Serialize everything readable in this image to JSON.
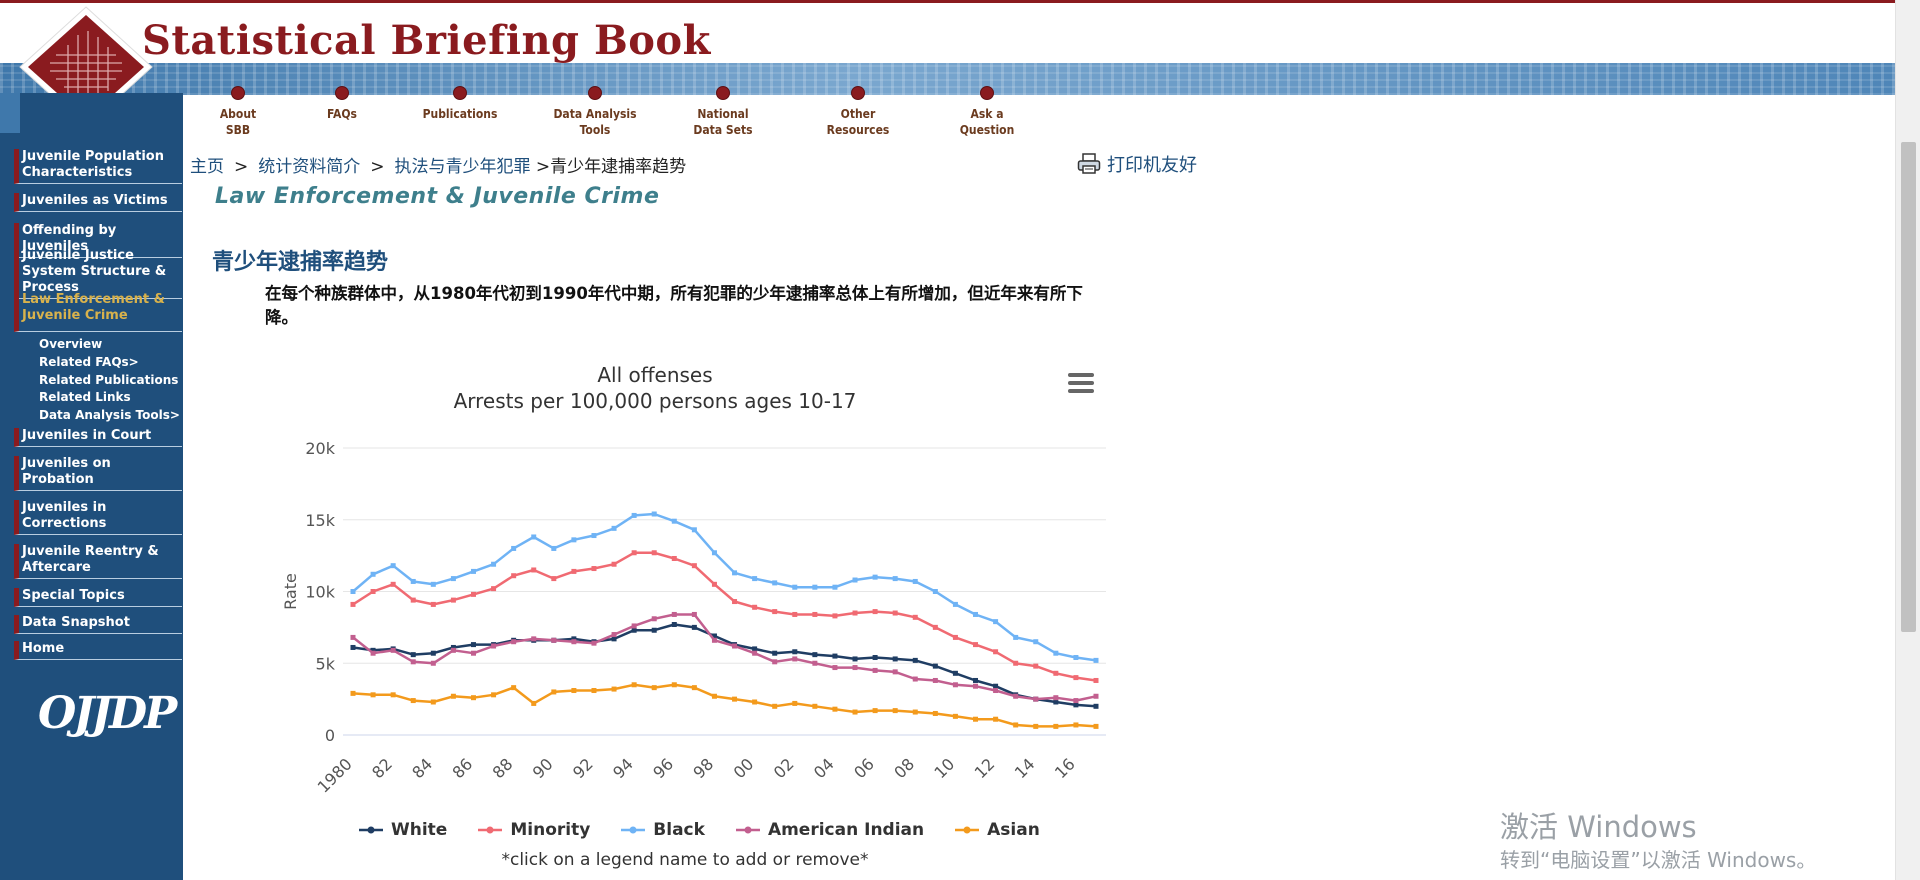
{
  "header": {
    "site_title": "Statistical Briefing Book",
    "top_nav": [
      {
        "line1": "About",
        "line2": "SBB"
      },
      {
        "line1": "FAQs",
        "line2": ""
      },
      {
        "line1": "Publications",
        "line2": ""
      },
      {
        "line1": "Data Analysis",
        "line2": "Tools"
      },
      {
        "line1": "National",
        "line2": "Data Sets"
      },
      {
        "line1": "Other",
        "line2": "Resources"
      },
      {
        "line1": "Ask a",
        "line2": "Question"
      }
    ]
  },
  "sidebar": {
    "items": [
      {
        "label": "Juvenile Population Characteristics"
      },
      {
        "label": "Juveniles as Victims"
      },
      {
        "label": "Offending by Juveniles"
      },
      {
        "label": "Juvenile Justice System Structure & Process"
      },
      {
        "label": "Law Enforcement & Juvenile Crime"
      },
      {
        "label": "Juveniles in Court"
      },
      {
        "label": "Juveniles on Probation"
      },
      {
        "label": "Juveniles in Corrections"
      },
      {
        "label": "Juvenile Reentry & Aftercare"
      },
      {
        "label": "Special Topics"
      },
      {
        "label": "Data Snapshot"
      },
      {
        "label": "Home"
      }
    ],
    "sub_items": [
      {
        "label": "Overview"
      },
      {
        "label": "Related FAQs>"
      },
      {
        "label": "Related Publications"
      },
      {
        "label": "Related Links"
      },
      {
        "label": "Data Analysis Tools>"
      }
    ],
    "logo_text": "OJJDP"
  },
  "breadcrumb": {
    "home": "主页",
    "level2": "统计资料简介",
    "level3": "执法与青少年犯罪",
    "current": ">青少年逮捕率趋势",
    "separator": ">"
  },
  "print_label": "打印机友好",
  "section_banner": "Law Enforcement & Juvenile Crime",
  "page_title": "青少年逮捕率趋势",
  "intro": "在每个种族群体中，从1980年代初到1990年代中期，所有犯罪的少年逮捕率总体上有所增加，但近年来有所下降。",
  "chart_data": {
    "type": "line",
    "title": "All offenses",
    "subtitle": "Arrests per 100,000 persons ages 10-17",
    "ylabel": "Rate",
    "ylim": [
      0,
      20000
    ],
    "yticks": [
      0,
      5000,
      10000,
      15000,
      20000
    ],
    "ytick_labels": [
      "0",
      "5k",
      "10k",
      "15k",
      "20k"
    ],
    "x": [
      1980,
      1981,
      1982,
      1983,
      1984,
      1985,
      1986,
      1987,
      1988,
      1989,
      1990,
      1991,
      1992,
      1993,
      1994,
      1995,
      1996,
      1997,
      1998,
      1999,
      2000,
      2001,
      2002,
      2003,
      2004,
      2005,
      2006,
      2007,
      2008,
      2009,
      2010,
      2011,
      2012,
      2013,
      2014,
      2015,
      2016,
      2017
    ],
    "xtick_labels": [
      "1980",
      "82",
      "84",
      "86",
      "88",
      "90",
      "92",
      "94",
      "96",
      "98",
      "00",
      "02",
      "04",
      "06",
      "08",
      "10",
      "12",
      "14",
      "16"
    ],
    "series": [
      {
        "name": "White",
        "color": "#1f3d63",
        "values": [
          6100,
          5900,
          6000,
          5600,
          5700,
          6100,
          6300,
          6300,
          6600,
          6600,
          6600,
          6700,
          6500,
          6700,
          7300,
          7300,
          7700,
          7500,
          6900,
          6300,
          6000,
          5700,
          5800,
          5600,
          5500,
          5300,
          5400,
          5300,
          5200,
          4800,
          4300,
          3800,
          3400,
          2800,
          2500,
          2300,
          2100,
          2000
        ]
      },
      {
        "name": "Minority",
        "color": "#f06a72",
        "values": [
          9100,
          10000,
          10500,
          9400,
          9100,
          9400,
          9800,
          10200,
          11100,
          11500,
          10900,
          11400,
          11600,
          11900,
          12700,
          12700,
          12300,
          11800,
          10500,
          9300,
          8900,
          8600,
          8400,
          8400,
          8300,
          8500,
          8600,
          8500,
          8200,
          7500,
          6800,
          6300,
          5800,
          5000,
          4800,
          4300,
          4000,
          3800
        ]
      },
      {
        "name": "Black",
        "color": "#6fb3f5",
        "values": [
          10000,
          11200,
          11800,
          10700,
          10500,
          10900,
          11400,
          11900,
          13000,
          13800,
          13000,
          13600,
          13900,
          14400,
          15300,
          15400,
          14900,
          14300,
          12700,
          11300,
          10900,
          10600,
          10300,
          10300,
          10300,
          10800,
          11000,
          10900,
          10700,
          10000,
          9100,
          8400,
          7900,
          6800,
          6500,
          5700,
          5400,
          5200
        ]
      },
      {
        "name": "American Indian",
        "color": "#c25f8f",
        "values": [
          6800,
          5700,
          5900,
          5100,
          5000,
          5900,
          5700,
          6200,
          6500,
          6700,
          6600,
          6500,
          6400,
          7000,
          7600,
          8100,
          8400,
          8400,
          6600,
          6200,
          5700,
          5100,
          5300,
          5000,
          4700,
          4700,
          4500,
          4400,
          3900,
          3800,
          3500,
          3400,
          3100,
          2700,
          2500,
          2600,
          2400,
          2700
        ]
      },
      {
        "name": "Asian",
        "color": "#f39a1c",
        "values": [
          2900,
          2800,
          2800,
          2400,
          2300,
          2700,
          2600,
          2800,
          3300,
          2200,
          3000,
          3100,
          3100,
          3200,
          3500,
          3300,
          3500,
          3300,
          2700,
          2500,
          2300,
          2000,
          2200,
          2000,
          1800,
          1600,
          1700,
          1700,
          1600,
          1500,
          1300,
          1100,
          1100,
          700,
          600,
          600,
          700,
          600
        ]
      }
    ],
    "legend_position": "bottom",
    "legend_note": "*click on a legend name to add or remove*",
    "grid": true
  },
  "watermark": {
    "line1": "激活 Windows",
    "line2": "转到“电脑设置”以激活 Windows。"
  }
}
